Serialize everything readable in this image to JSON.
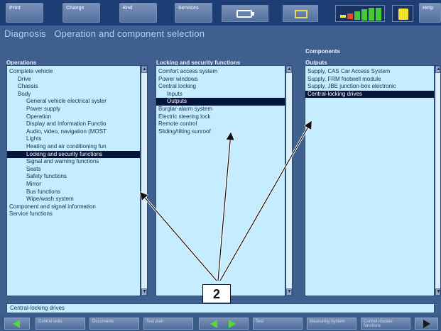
{
  "toolbar": {
    "buttons": [
      "Print",
      "Change",
      "End",
      "Services"
    ]
  },
  "help_label": "Help",
  "title": {
    "prefix": "Diagnosis",
    "text": "Operation and component selection"
  },
  "columns": {
    "operations": {
      "header": "Operations",
      "items": [
        {
          "label": "Complete vehicle",
          "indent": 0,
          "selected": false
        },
        {
          "label": "Drive",
          "indent": 1,
          "selected": false
        },
        {
          "label": "Chassis",
          "indent": 1,
          "selected": false
        },
        {
          "label": "Body",
          "indent": 1,
          "selected": false
        },
        {
          "label": "General vehicle electrical syster",
          "indent": 2,
          "selected": false
        },
        {
          "label": "Power supply",
          "indent": 2,
          "selected": false
        },
        {
          "label": "Operation",
          "indent": 2,
          "selected": false
        },
        {
          "label": "Display and Information Functio",
          "indent": 2,
          "selected": false
        },
        {
          "label": "Audio, video, navigation (MOST",
          "indent": 2,
          "selected": false
        },
        {
          "label": "Lights",
          "indent": 2,
          "selected": false
        },
        {
          "label": "Heating and air conditioning fun",
          "indent": 2,
          "selected": false
        },
        {
          "label": "Locking and security functions",
          "indent": 2,
          "selected": true
        },
        {
          "label": "Signal and warning functions",
          "indent": 2,
          "selected": false
        },
        {
          "label": "Seats",
          "indent": 2,
          "selected": false
        },
        {
          "label": "Safety functions",
          "indent": 2,
          "selected": false
        },
        {
          "label": "Mirror",
          "indent": 2,
          "selected": false
        },
        {
          "label": "Bus functions",
          "indent": 2,
          "selected": false
        },
        {
          "label": "Wipe/wash system",
          "indent": 2,
          "selected": false
        },
        {
          "label": "Component and signal information",
          "indent": 0,
          "selected": false
        },
        {
          "label": "Service functions",
          "indent": 0,
          "selected": false
        }
      ]
    },
    "locking": {
      "header": "Locking and security functions",
      "items": [
        {
          "label": "Comfort access system",
          "indent": 0,
          "selected": false
        },
        {
          "label": "Power windows",
          "indent": 0,
          "selected": false
        },
        {
          "label": "Central locking",
          "indent": 0,
          "selected": false
        },
        {
          "label": "Inputs",
          "indent": 1,
          "selected": false
        },
        {
          "label": "Outputs",
          "indent": 1,
          "selected": true
        },
        {
          "label": "Burglar-alarm system",
          "indent": 0,
          "selected": false
        },
        {
          "label": "Electric steering lock",
          "indent": 0,
          "selected": false
        },
        {
          "label": "Remote control",
          "indent": 0,
          "selected": false
        },
        {
          "label": "Sliding/tilting sunroof",
          "indent": 0,
          "selected": false
        }
      ]
    },
    "components": {
      "header_top": "Components",
      "header": "Outputs",
      "items": [
        {
          "label": "Supply, CAS Car Access System",
          "indent": 0,
          "selected": false
        },
        {
          "label": "Supply, FRM footwell module",
          "indent": 0,
          "selected": false
        },
        {
          "label": "Supply, JBE junction-box electronic",
          "indent": 0,
          "selected": false
        },
        {
          "label": "Central-locking drives",
          "indent": 0,
          "selected": true
        }
      ]
    }
  },
  "status_text": "Central-locking drives",
  "bottom_buttons": [
    "Control units",
    "Documents",
    "Test plan",
    "Test",
    "Measuring System",
    "Control module functions"
  ],
  "callout": "2",
  "colors": {
    "panel_bg": "#c5ecff",
    "selection_bg": "#05143b",
    "title_color": "#a8d4ff",
    "nav_arrow_green": "#58d63a"
  }
}
